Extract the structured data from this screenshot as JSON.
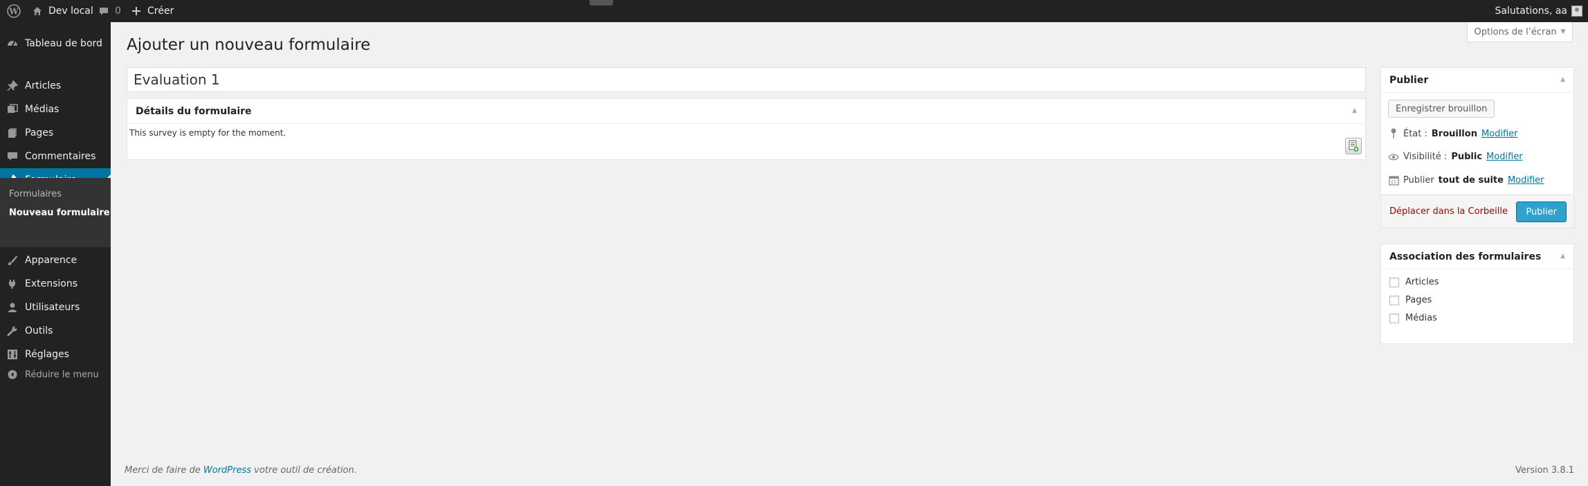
{
  "adminbar": {
    "site_name": "Dev local",
    "comments_count": "0",
    "new_label": "Créer",
    "greeting": "Salutations, aa"
  },
  "sidebar": {
    "items": [
      {
        "label": "Tableau de bord",
        "icon": "dashboard-icon"
      },
      {
        "label": "Articles",
        "icon": "pin-icon"
      },
      {
        "label": "Médias",
        "icon": "media-icon"
      },
      {
        "label": "Pages",
        "icon": "pages-icon"
      },
      {
        "label": "Commentaires",
        "icon": "comment-icon"
      },
      {
        "label": "Formulaire",
        "icon": "pin-icon"
      },
      {
        "label": "Apparence",
        "icon": "brush-icon"
      },
      {
        "label": "Extensions",
        "icon": "plugin-icon"
      },
      {
        "label": "Utilisateurs",
        "icon": "user-icon"
      },
      {
        "label": "Outils",
        "icon": "wrench-icon"
      },
      {
        "label": "Réglages",
        "icon": "settings-icon"
      }
    ],
    "submenu": [
      "Formulaires",
      "Nouveau formulaire"
    ],
    "collapse_label": "Réduire le menu"
  },
  "screen_options": "Options de l’écran",
  "page_title": "Ajouter un nouveau formulaire",
  "title_value": "Evaluation 1",
  "details": {
    "title": "Détails du formulaire",
    "empty_text": "This survey is empty for the moment."
  },
  "publish": {
    "title": "Publier",
    "save_draft": "Enregistrer brouillon",
    "status_label": "État :",
    "status_value": "Brouillon",
    "visibility_label": "Visibilité :",
    "visibility_value": "Public",
    "publish_label": "Publier",
    "publish_value": "tout de suite",
    "edit_link": "Modifier",
    "trash": "Déplacer dans la Corbeille",
    "publish_button": "Publier"
  },
  "association": {
    "title": "Association des formulaires",
    "options": [
      "Articles",
      "Pages",
      "Médias"
    ]
  },
  "footer": {
    "thanks_prefix": "Merci de faire de",
    "thanks_link": "WordPress",
    "thanks_suffix": "votre outil de création.",
    "version": "Version 3.8.1"
  }
}
